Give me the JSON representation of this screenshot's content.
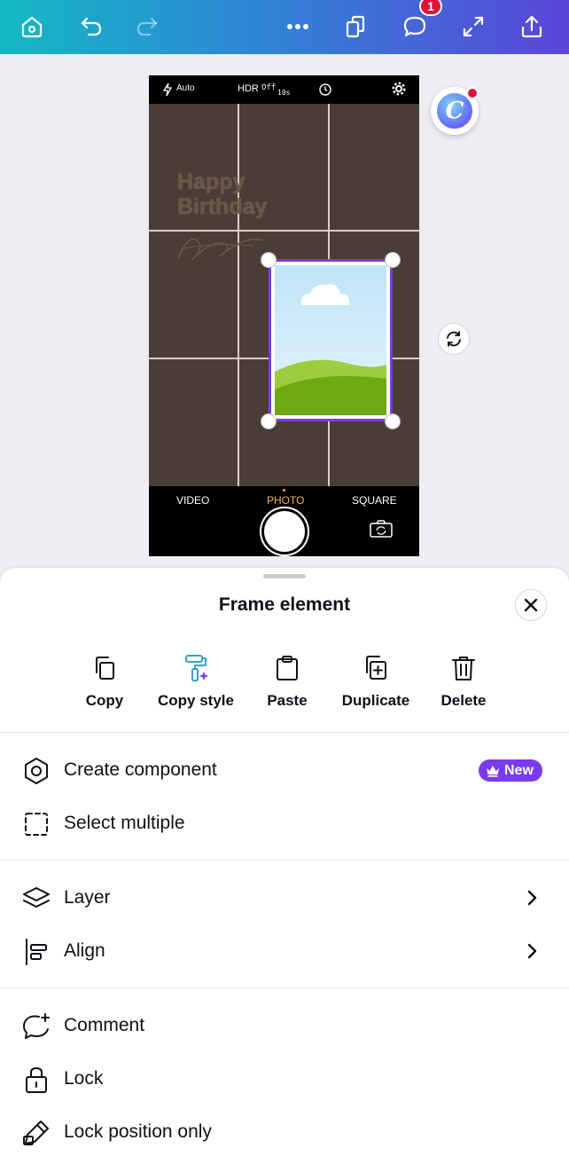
{
  "toolbar": {
    "comment_count": "1"
  },
  "camera": {
    "flash": "Auto",
    "hdr": "HDR",
    "hdr_state": "Off",
    "timer": "10s",
    "modes": [
      "VIDEO",
      "PHOTO",
      "SQUARE"
    ],
    "active_mode": "PHOTO",
    "canvas_text_line1": "Happy",
    "canvas_text_line2": "Birthday"
  },
  "sheet": {
    "title": "Frame element",
    "actions": [
      {
        "label": "Copy",
        "icon": "copy-icon"
      },
      {
        "label": "Copy style",
        "icon": "paint-roller-icon"
      },
      {
        "label": "Paste",
        "icon": "clipboard-icon"
      },
      {
        "label": "Duplicate",
        "icon": "duplicate-icon"
      },
      {
        "label": "Delete",
        "icon": "trash-icon"
      }
    ],
    "menu": [
      {
        "label": "Create component",
        "icon": "component-icon",
        "badge": "New"
      },
      {
        "label": "Select multiple",
        "icon": "dashed-square-icon"
      },
      {
        "label": "Layer",
        "icon": "layers-icon"
      },
      {
        "label": "Align",
        "icon": "align-left-icon"
      },
      {
        "label": "Comment",
        "icon": "comment-add-icon"
      },
      {
        "label": "Lock",
        "icon": "lock-icon"
      },
      {
        "label": "Lock position only",
        "icon": "edit-lock-icon"
      }
    ]
  },
  "colors": {
    "accent": "#7c3aed",
    "notification": "#e0123b"
  }
}
